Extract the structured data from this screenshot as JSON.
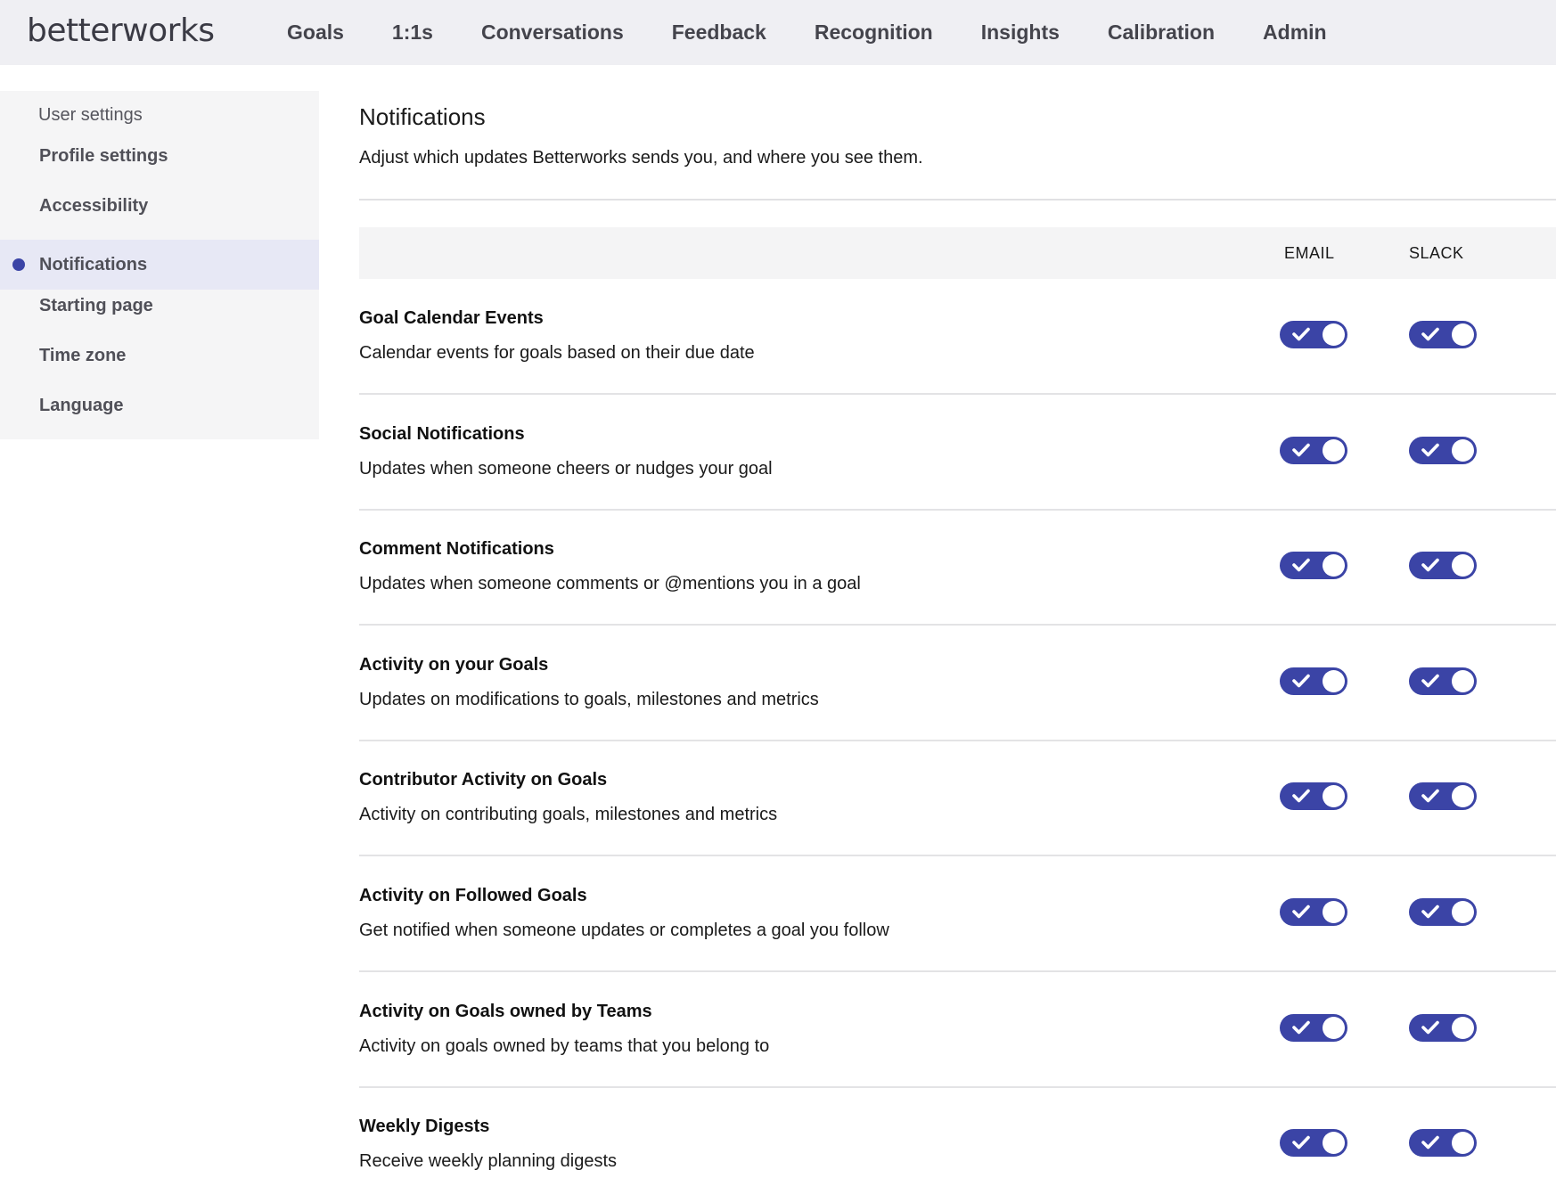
{
  "app": {
    "logo_text": "betterworks"
  },
  "nav": {
    "items": [
      {
        "label": "Goals"
      },
      {
        "label": "1:1s"
      },
      {
        "label": "Conversations"
      },
      {
        "label": "Feedback"
      },
      {
        "label": "Recognition"
      },
      {
        "label": "Insights"
      },
      {
        "label": "Calibration"
      },
      {
        "label": "Admin"
      }
    ]
  },
  "sidebar": {
    "heading": "User settings",
    "items": [
      {
        "label": "Profile settings",
        "active": false
      },
      {
        "label": "Accessibility",
        "active": false
      },
      {
        "label": "Notifications",
        "active": true
      },
      {
        "label": "Starting page",
        "active": false
      },
      {
        "label": "Time zone",
        "active": false
      },
      {
        "label": "Language",
        "active": false
      }
    ]
  },
  "main": {
    "title": "Notifications",
    "description": "Adjust which updates Betterworks sends you, and where you see them.",
    "columns": {
      "email": "EMAIL",
      "slack": "SLACK"
    },
    "rows": [
      {
        "title": "Goal Calendar Events",
        "description": "Calendar events for goals based on their due date",
        "email": true,
        "slack": true
      },
      {
        "title": "Social Notifications",
        "description": "Updates when someone cheers or nudges your goal",
        "email": true,
        "slack": true
      },
      {
        "title": "Comment Notifications",
        "description": "Updates when someone comments or @mentions you in a goal",
        "email": true,
        "slack": true
      },
      {
        "title": "Activity on your Goals",
        "description": "Updates on modifications to goals, milestones and metrics",
        "email": true,
        "slack": true
      },
      {
        "title": "Contributor Activity on Goals",
        "description": "Activity on contributing goals, milestones and metrics",
        "email": true,
        "slack": true
      },
      {
        "title": "Activity on Followed Goals",
        "description": "Get notified when someone updates or completes a goal you follow",
        "email": true,
        "slack": true
      },
      {
        "title": "Activity on Goals owned by Teams",
        "description": "Activity on goals owned by teams that you belong to",
        "email": true,
        "slack": true
      },
      {
        "title": "Weekly Digests",
        "description": "Receive weekly planning digests",
        "email": true,
        "slack": true
      }
    ]
  },
  "colors": {
    "accent": "#3b44a6",
    "nav_bg": "#efeff3",
    "sidebar_bg": "#f5f5f6",
    "sidebar_active_bg": "#e7e8f5",
    "header_row_bg": "#f4f4f5"
  }
}
